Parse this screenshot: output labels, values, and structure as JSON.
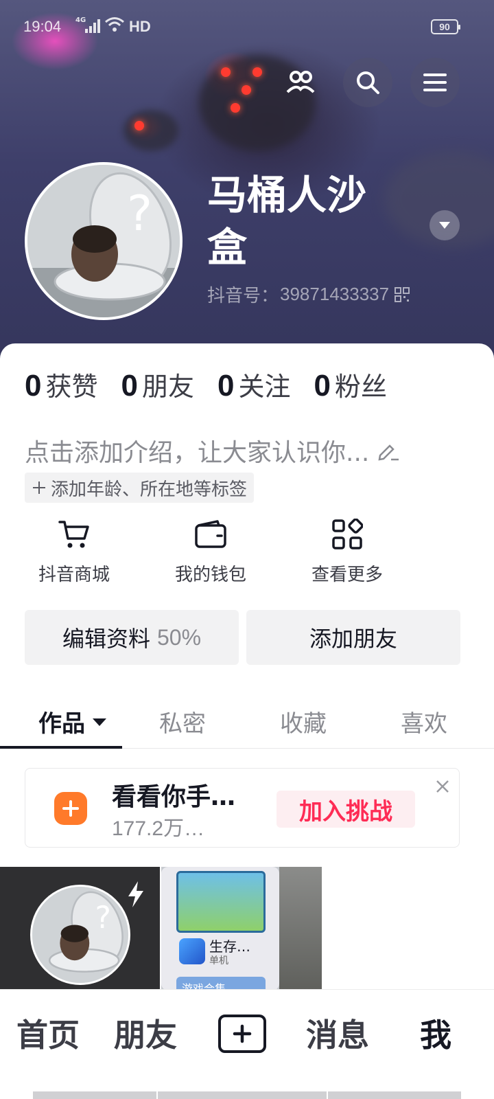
{
  "status_bar": {
    "time": "19:04",
    "network": "4G",
    "hd": "HD",
    "battery": "90"
  },
  "header": {
    "friends_icon": "people-icon",
    "search_icon": "search-icon",
    "menu_icon": "hamburger-menu-icon"
  },
  "profile": {
    "nickname": "马桶人沙盒",
    "douyin_id_label": "抖音号：",
    "douyin_id": "39871433337",
    "bio_placeholder": "点击添加介绍，让大家认识你...",
    "tag_prompt": "添加年龄、所在地等标签"
  },
  "stats": [
    {
      "value": "0",
      "label": "获赞"
    },
    {
      "value": "0",
      "label": "朋友"
    },
    {
      "value": "0",
      "label": "关注"
    },
    {
      "value": "0",
      "label": "粉丝"
    }
  ],
  "shortcuts": [
    {
      "label": "抖音商城",
      "icon": "cart-icon"
    },
    {
      "label": "我的钱包",
      "icon": "wallet-icon"
    },
    {
      "label": "查看更多",
      "icon": "grid-more-icon"
    }
  ],
  "actions": {
    "edit_profile": "编辑资料",
    "edit_progress": "50%",
    "add_friends": "添加朋友"
  },
  "tabs": [
    {
      "label": "作品",
      "active": true
    },
    {
      "label": "私密",
      "active": false
    },
    {
      "label": "收藏",
      "active": false
    },
    {
      "label": "喜欢",
      "active": false
    }
  ],
  "challenge": {
    "title": "看看你手…",
    "subtitle": "177.2万…",
    "join_label": "加入挑战"
  },
  "videos": [
    {
      "type": "avatar-thumbnail"
    },
    {
      "app_title": "生存…",
      "app_sub": "单机",
      "pill_text": "游戏合集"
    }
  ],
  "bottom_nav": [
    {
      "label": "首页",
      "active": false
    },
    {
      "label": "朋友",
      "active": false
    },
    {
      "label": "消息",
      "active": false
    },
    {
      "label": "我",
      "active": true
    }
  ],
  "colors": {
    "accent": "#fe2c55",
    "challenge_icon": "#ff7a2a",
    "text_primary": "#161823",
    "text_secondary": "#8a8b91"
  }
}
